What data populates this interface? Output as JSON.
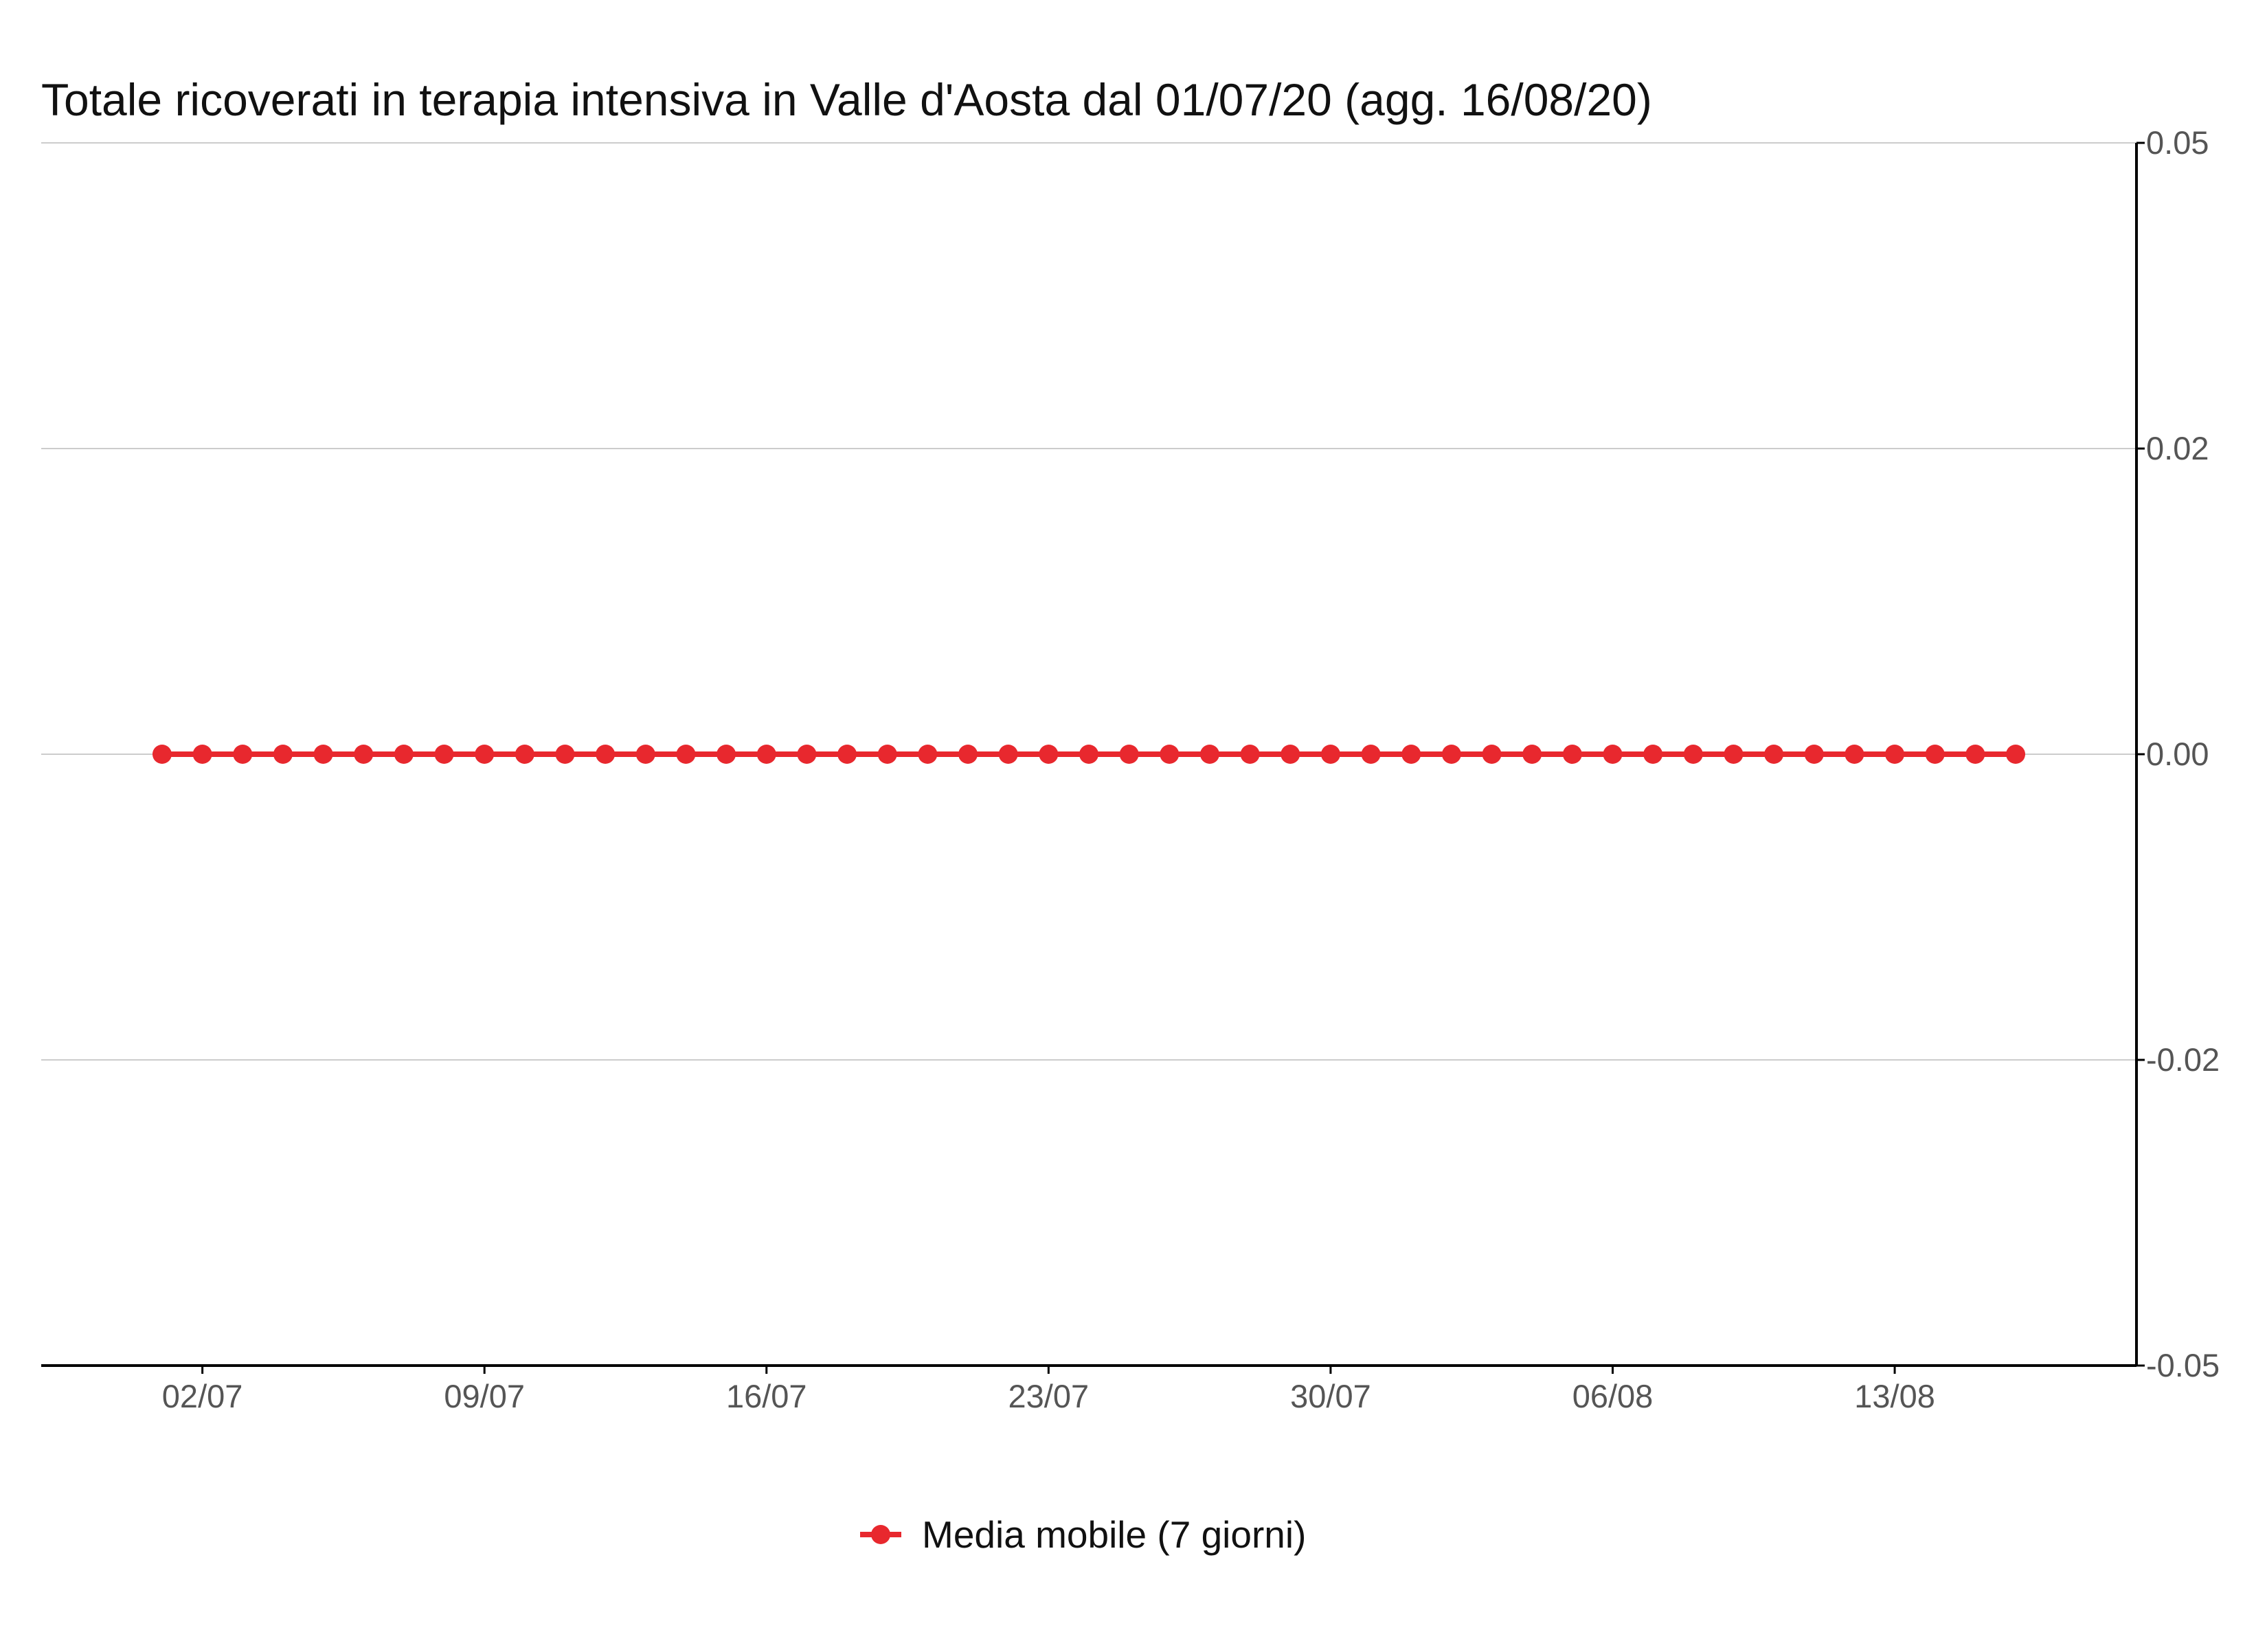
{
  "chart_data": {
    "type": "line",
    "title": "Totale ricoverati in terapia intensiva in Valle d'Aosta dal 01/07/20 (agg. 16/08/20)",
    "xlabel": "",
    "ylabel": "",
    "x": [
      "2020-07-01",
      "2020-07-02",
      "2020-07-03",
      "2020-07-04",
      "2020-07-05",
      "2020-07-06",
      "2020-07-07",
      "2020-07-08",
      "2020-07-09",
      "2020-07-10",
      "2020-07-11",
      "2020-07-12",
      "2020-07-13",
      "2020-07-14",
      "2020-07-15",
      "2020-07-16",
      "2020-07-17",
      "2020-07-18",
      "2020-07-19",
      "2020-07-20",
      "2020-07-21",
      "2020-07-22",
      "2020-07-23",
      "2020-07-24",
      "2020-07-25",
      "2020-07-26",
      "2020-07-27",
      "2020-07-28",
      "2020-07-29",
      "2020-07-30",
      "2020-07-31",
      "2020-08-01",
      "2020-08-02",
      "2020-08-03",
      "2020-08-04",
      "2020-08-05",
      "2020-08-06",
      "2020-08-07",
      "2020-08-08",
      "2020-08-09",
      "2020-08-10",
      "2020-08-11",
      "2020-08-12",
      "2020-08-13",
      "2020-08-14",
      "2020-08-15",
      "2020-08-16"
    ],
    "series": [
      {
        "name": "Media mobile (7 giorni)",
        "color": "#e8282e",
        "values": [
          0,
          0,
          0,
          0,
          0,
          0,
          0,
          0,
          0,
          0,
          0,
          0,
          0,
          0,
          0,
          0,
          0,
          0,
          0,
          0,
          0,
          0,
          0,
          0,
          0,
          0,
          0,
          0,
          0,
          0,
          0,
          0,
          0,
          0,
          0,
          0,
          0,
          0,
          0,
          0,
          0,
          0,
          0,
          0,
          0,
          0,
          0
        ]
      }
    ],
    "x_tick_labels": [
      "02/07",
      "09/07",
      "16/07",
      "23/07",
      "30/07",
      "06/08",
      "13/08"
    ],
    "x_tick_dates": [
      "2020-07-02",
      "2020-07-09",
      "2020-07-16",
      "2020-07-23",
      "2020-07-30",
      "2020-08-06",
      "2020-08-13"
    ],
    "y_tick_labels": [
      "0.05",
      "0.02",
      "0.00",
      "-0.02",
      "-0.05"
    ],
    "y_tick_values": [
      0.05,
      0.025,
      0,
      -0.025,
      -0.05
    ],
    "ylim": [
      -0.05,
      0.05
    ],
    "xlim": [
      "2020-06-28",
      "2020-08-19"
    ],
    "y_axis_position": "right",
    "grid": "horizontal",
    "legend_position": "bottom",
    "colors": {
      "series": "#e8282e",
      "grid": "#cccccc",
      "axis": "#000000",
      "tick_text": "#555555",
      "title_text": "#111111"
    }
  }
}
